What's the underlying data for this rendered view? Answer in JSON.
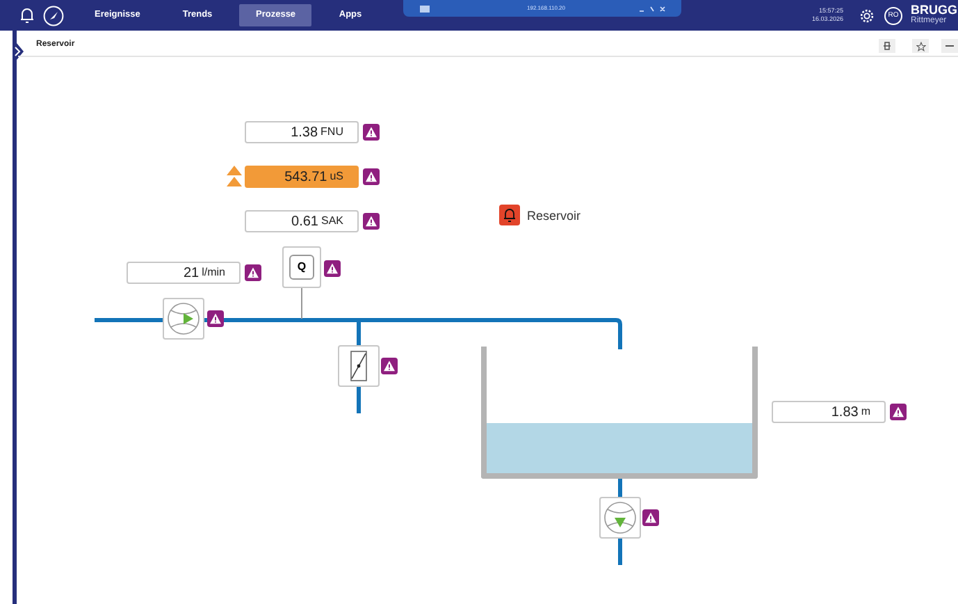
{
  "nav": {
    "tabs": [
      {
        "label": "Ereignisse",
        "selected": false
      },
      {
        "label": "Trends",
        "selected": false
      },
      {
        "label": "Prozesse",
        "selected": true
      },
      {
        "label": "Apps",
        "selected": false
      }
    ]
  },
  "remote_bar": {
    "address": "192.168.110.20"
  },
  "header": {
    "time": "15:57:25",
    "date": "16.03.2026",
    "user": "RO",
    "brand": "BRUGG",
    "brand_sub": "Rittmeyer"
  },
  "breadcrumb": "Reservoir",
  "alarm": {
    "label": "Reservoir"
  },
  "measurements": [
    {
      "value": "1.38",
      "unit": "FNU",
      "high_alarm": false
    },
    {
      "value": "543.71",
      "unit": "uS",
      "high_alarm": true
    },
    {
      "value": "0.61",
      "unit": "SAK",
      "high_alarm": false
    },
    {
      "value": "21",
      "unit": "l/min",
      "high_alarm": false
    },
    {
      "value": "1.83",
      "unit": "m",
      "high_alarm": false
    }
  ],
  "analyzer": {
    "label": "Q"
  },
  "pumps": [
    {
      "flow_down": false
    },
    {
      "flow_down": true
    }
  ]
}
